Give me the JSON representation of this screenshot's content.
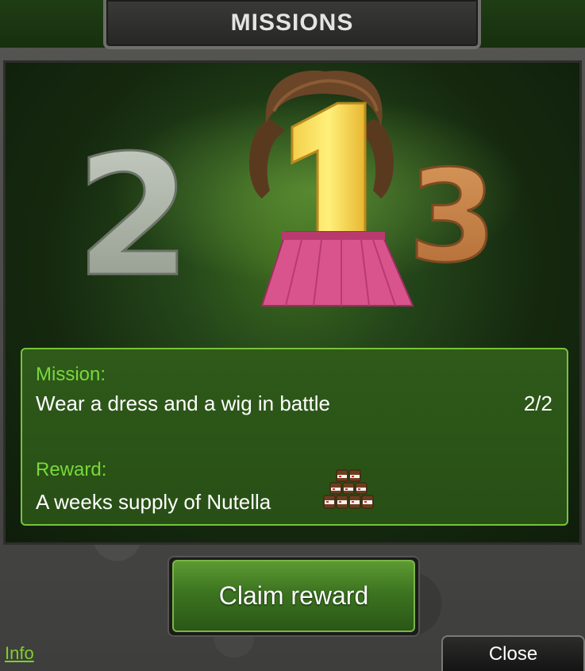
{
  "header": {
    "title": "MISSIONS"
  },
  "podium": {
    "first": "1",
    "second": "2",
    "third": "3"
  },
  "mission": {
    "label": "Mission:",
    "description": "Wear a dress and a wig in battle",
    "progress": "2/2"
  },
  "reward": {
    "label": "Reward:",
    "description": "A weeks supply of Nutella",
    "icon": "nutella-jars-icon"
  },
  "actions": {
    "claim_label": "Claim reward",
    "info_label": "Info",
    "close_label": "Close"
  },
  "colors": {
    "accent_green": "#79d93a",
    "panel_green": "#24461a",
    "box_border": "#77c33a"
  }
}
